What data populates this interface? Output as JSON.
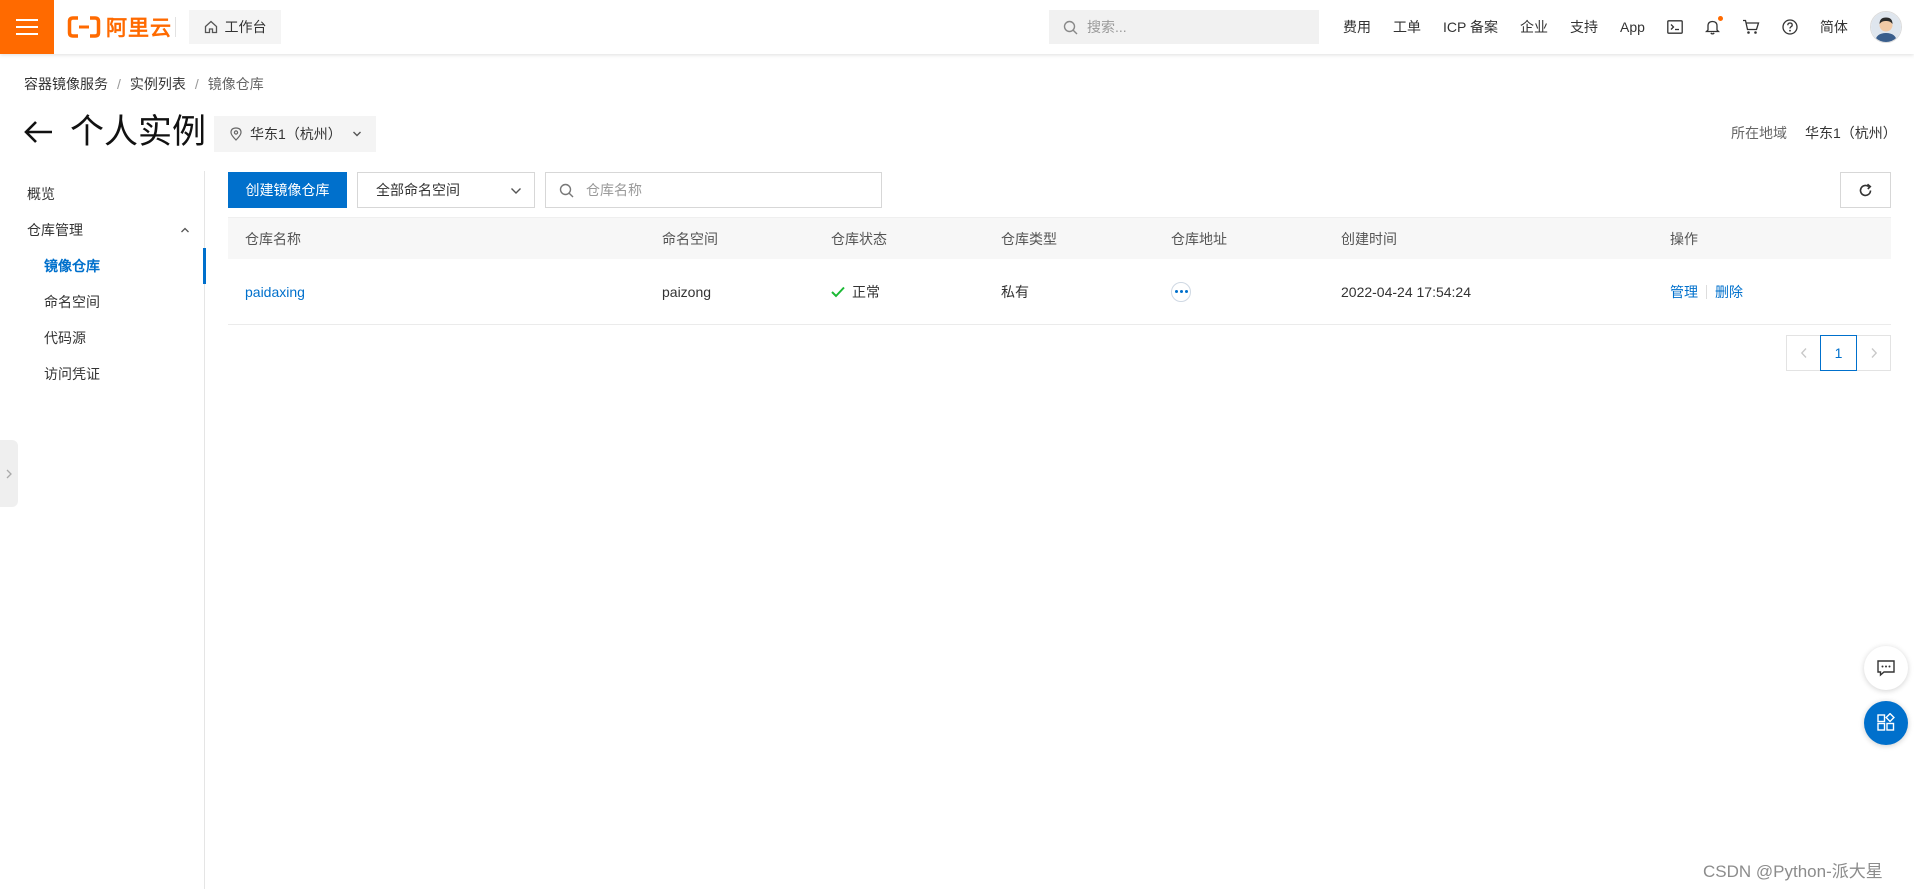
{
  "topbar": {
    "logo_text": "阿里云",
    "workbench_label": "工作台",
    "search_placeholder": "搜索...",
    "nav": [
      "费用",
      "工单",
      "ICP 备案",
      "企业",
      "支持",
      "App"
    ],
    "lang": "简体"
  },
  "breadcrumb": {
    "items": [
      "容器镜像服务",
      "实例列表",
      "镜像仓库"
    ],
    "separator": "/"
  },
  "header": {
    "title": "个人实例",
    "region_select": "华东1（杭州）",
    "region_label": "所在地域",
    "region_value": "华东1（杭州）"
  },
  "sidebar": {
    "overview": "概览",
    "group": "仓库管理",
    "items": [
      "镜像仓库",
      "命名空间",
      "代码源",
      "访问凭证"
    ],
    "active": "镜像仓库"
  },
  "toolbar": {
    "create_label": "创建镜像仓库",
    "namespace_select": "全部命名空间",
    "search_placeholder": "仓库名称"
  },
  "table": {
    "columns": [
      "仓库名称",
      "命名空间",
      "仓库状态",
      "仓库类型",
      "仓库地址",
      "创建时间",
      "操作"
    ],
    "rows": [
      {
        "name": "paidaxing",
        "namespace": "paizong",
        "status": "正常",
        "type": "私有",
        "created": "2022-04-24 17:54:24",
        "actions": [
          "管理",
          "删除"
        ]
      }
    ]
  },
  "pagination": {
    "current": "1"
  },
  "watermark": "CSDN @Python-派大星",
  "colors": {
    "accent": "#0070cc",
    "brand": "#ff6a00",
    "success": "#1bb934"
  },
  "icons": [
    "hamburger-icon",
    "aliyun-logo-icon",
    "home-icon",
    "search-icon",
    "terminal-icon",
    "bell-icon",
    "cart-icon",
    "help-icon",
    "avatar",
    "back-arrow-icon",
    "location-pin-icon",
    "chevron-down-icon",
    "chevron-up-icon",
    "refresh-icon",
    "check-icon",
    "more-icon",
    "chevron-left-icon",
    "chevron-right-icon",
    "chat-icon",
    "apps-icon"
  ]
}
